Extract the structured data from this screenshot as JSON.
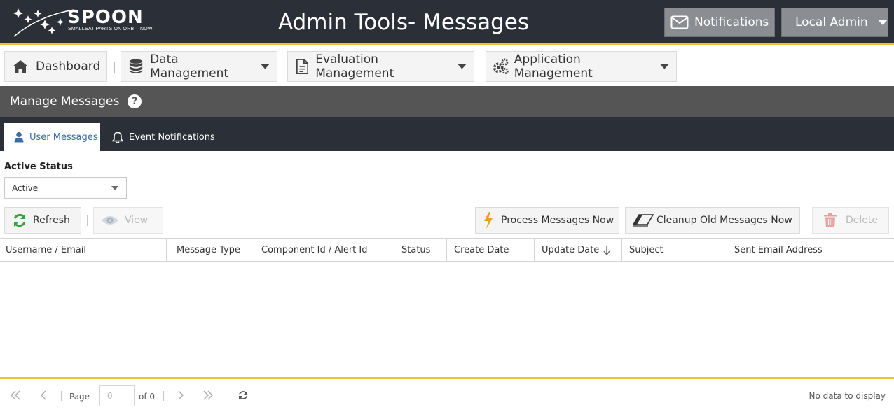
{
  "header": {
    "logo_word": "SPOON",
    "logo_tagline": "SMALLSAT PARTS ON ORBIT NOW",
    "title": "Admin Tools- Messages",
    "notifications_label": "Notifications",
    "user_label": "Local Admin"
  },
  "nav": {
    "items": [
      {
        "label": "Dashboard",
        "icon": "home-icon"
      },
      {
        "label": "Data Management",
        "icon": "database-icon"
      },
      {
        "label": "Evaluation Management",
        "icon": "document-icon"
      },
      {
        "label": "Application Management",
        "icon": "gears-icon"
      }
    ]
  },
  "section": {
    "title": "Manage Messages"
  },
  "tabs": [
    {
      "label": "User Messages",
      "icon": "user-icon",
      "active": true
    },
    {
      "label": "Event Notifications",
      "icon": "bell-icon",
      "active": false
    }
  ],
  "filter": {
    "label": "Active Status",
    "value": "Active"
  },
  "toolbar": {
    "refresh": "Refresh",
    "view": "View",
    "process": "Process Messages Now",
    "cleanup": "Cleanup Old Messages Now",
    "delete": "Delete"
  },
  "grid": {
    "columns": [
      "Username / Email",
      "Message Type",
      "Component Id / Alert Id",
      "Status",
      "Create Date",
      "Update Date",
      "Subject",
      "Sent Email Address"
    ],
    "rows": []
  },
  "pager": {
    "page_label": "Page",
    "page_value": "0",
    "of_label": "of 0",
    "status": "No data to display"
  },
  "colors": {
    "header_bg": "#2b2f38",
    "accent": "#f2c12e",
    "section_bg": "#555555",
    "active_tab_text": "#3a6ea5",
    "refresh_green": "#3aa03a",
    "process_orange": "#f29b1d",
    "delete_red": "#e08080"
  }
}
